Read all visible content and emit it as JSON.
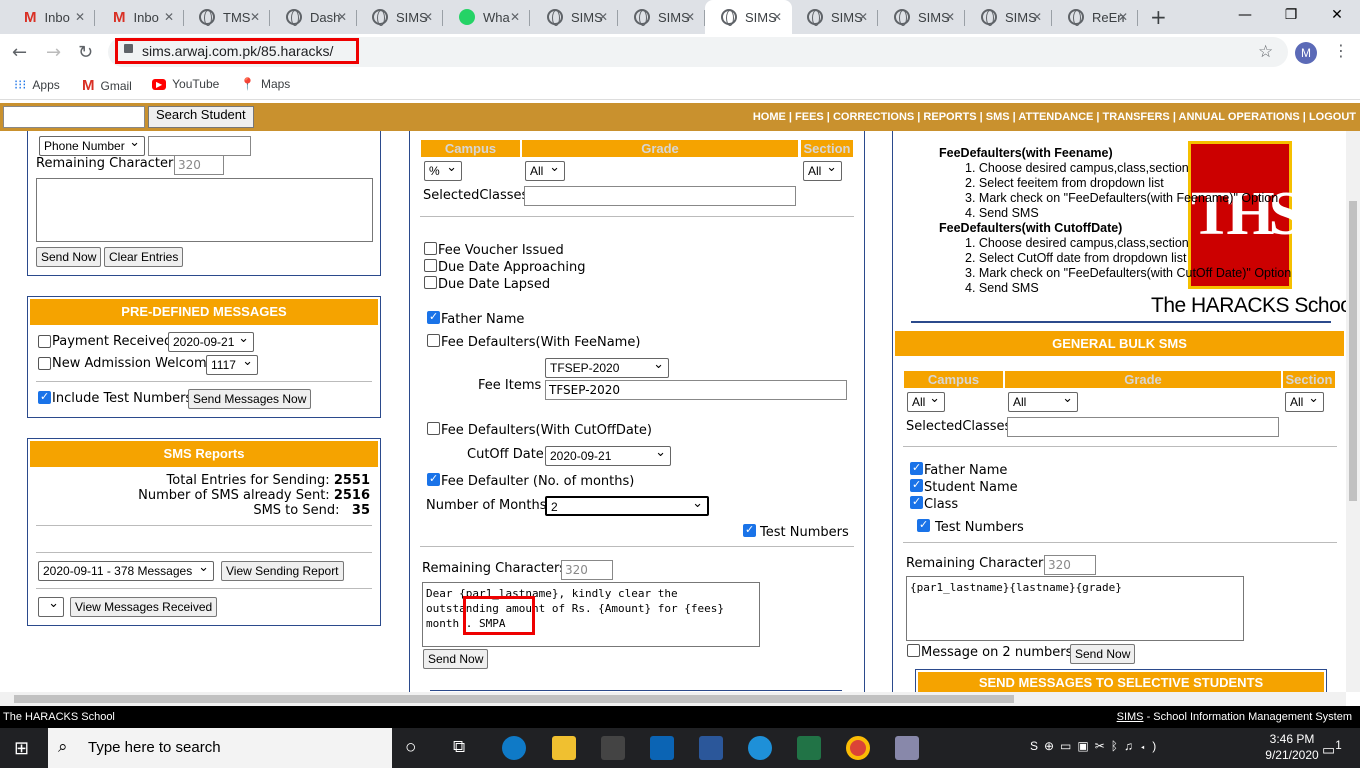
{
  "browser": {
    "tabs": [
      {
        "label": "Inbo",
        "icon": "gmail-icon"
      },
      {
        "label": "Inbo",
        "icon": "gmail-icon"
      },
      {
        "label": "TMS",
        "icon": "globe-icon"
      },
      {
        "label": "Dash",
        "icon": "globe-icon"
      },
      {
        "label": "SIMS",
        "icon": "globe-icon"
      },
      {
        "label": "Wha",
        "icon": "whatsapp-icon"
      },
      {
        "label": "SIMS",
        "icon": "globe-icon"
      },
      {
        "label": "SIMS",
        "icon": "globe-icon"
      },
      {
        "label": "SIMS",
        "icon": "globe-icon",
        "active": true
      },
      {
        "label": "SIMS",
        "icon": "globe-icon"
      },
      {
        "label": "SIMS",
        "icon": "globe-icon"
      },
      {
        "label": "SIMS",
        "icon": "globe-icon"
      },
      {
        "label": "ReEn",
        "icon": "globe-icon"
      }
    ],
    "url": "sims.arwaj.com.pk/85.haracks/",
    "profile_initial": "M",
    "bookmarks": [
      {
        "label": "Apps",
        "icon": "apps-grid-icon"
      },
      {
        "label": "Gmail",
        "icon": "gmail-icon"
      },
      {
        "label": "YouTube",
        "icon": "youtube-icon"
      },
      {
        "label": "Maps",
        "icon": "maps-pin-icon"
      }
    ]
  },
  "site": {
    "search_button": "Search Student",
    "nav": "HOME | FEES | CORRECTIONS | REPORTS | SMS | ATTENDANCE | TRANSFERS | ANNUAL OPERATIONS | LOGOUT"
  },
  "left": {
    "phone_select": "Phone Number",
    "remaining_label": "Remaining Characters:",
    "remaining_value": "320",
    "send_now": "Send Now",
    "clear_entries": "Clear Entries",
    "predefined": {
      "title": "PRE-DEFINED MESSAGES",
      "payment_received": "Payment Received",
      "payment_date": "2020-09-21",
      "new_admission": "New Admission Welcome",
      "new_admission_value": "1117",
      "include_test": "Include Test Numbers",
      "send_messages_now": "Send Messages Now"
    },
    "reports": {
      "title": "SMS Reports",
      "total_label": "Total Entries for Sending:",
      "total_value": "2551",
      "sent_label": "Number of SMS already Sent:",
      "sent_value": "2516",
      "tosend_label": "SMS to Send:",
      "tosend_value": "35",
      "report_select": "2020-09-11 - 378 Messages",
      "view_sending": "View Sending Report",
      "view_received": "View Messages Received"
    }
  },
  "middle": {
    "campus_hdr": "Campus",
    "grade_hdr": "Grade",
    "section_hdr": "Section",
    "campus_val": "%",
    "grade_val": "All",
    "section_val": "All",
    "selected_classes": "SelectedClasses",
    "fee_voucher": "Fee Voucher Issued",
    "due_approaching": "Due Date Approaching",
    "due_lapsed": "Due Date Lapsed",
    "father_name": "Father Name",
    "fee_defaulters_feename": "Fee Defaulters(With FeeName)",
    "fee_items_label": "Fee Items",
    "fee_items_select": "TFSEP-2020",
    "fee_items_text": "TFSEP-2020",
    "fee_defaulters_cutoff": "Fee Defaulters(With CutOffDate)",
    "cutoff_label": "CutOff Date",
    "cutoff_value": "2020-09-21",
    "fee_defaulter_months": "Fee Defaulter (No. of months)",
    "num_months_label": "Number of Months",
    "num_months_value": "2",
    "test_numbers": "Test Numbers",
    "remaining_label": "Remaining Characters:",
    "remaining_value": "320",
    "message": "Dear {par1_lastname}, kindly clear the outstanding amount of Rs. {Amount} for {fees} month . SMPA",
    "send_now": "Send Now"
  },
  "right": {
    "instructions": [
      {
        "title": "FeeDefaulters(with Feename)",
        "steps": [
          "Choose desired campus,class,section",
          "Select feeitem from dropdown list",
          "Mark check on \"FeeDefaulters(with Feename)\" Option",
          "Send SMS"
        ]
      },
      {
        "title": "FeeDefaulters(with CutoffDate)",
        "steps": [
          "Choose desired campus,class,section",
          "Select CutOff date from dropdown list",
          "Mark check on \"FeeDefaulters(with CutOff Date)\" Option",
          "Send SMS"
        ]
      }
    ],
    "logo_letters": "THS",
    "logo_text": "The HARACKS School",
    "bulk_title": "GENERAL BULK SMS",
    "campus_hdr": "Campus",
    "grade_hdr": "Grade",
    "section_hdr": "Section",
    "campus_val": "All",
    "grade_val": "All",
    "section_val": "All",
    "selected_classes": "SelectedClasses",
    "father_name": "Father Name",
    "student_name": "Student Name",
    "class_label": "Class",
    "test_numbers": "Test Numbers",
    "remaining_label": "Remaining Characters:",
    "remaining_value": "320",
    "message": "{par1_lastname}{lastname}{grade}",
    "two_numbers": "Message on 2 numbers",
    "send_now": "Send Now",
    "selective_title": "SEND MESSAGES TO SELECTIVE STUDENTS"
  },
  "footer": {
    "left": "The HARACKS School",
    "sims": "SIMS",
    "right": " - School Information Management System"
  },
  "taskbar": {
    "search_placeholder": "Type here to search",
    "time": "3:46 PM",
    "date": "9/21/2020",
    "notifications": "1"
  }
}
